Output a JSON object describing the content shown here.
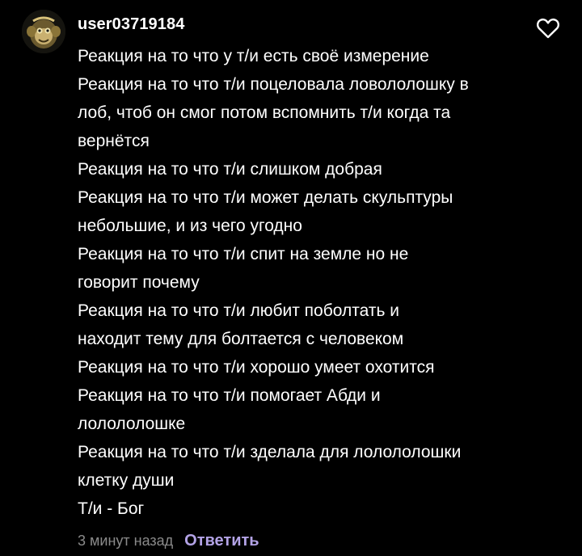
{
  "comment": {
    "username": "user03719184",
    "avatar_icon": "monkey-avatar-icon",
    "like_icon": "heart-outline-icon",
    "lines": [
      "Реакция на то что у т/и есть своё измерение",
      "Реакция на то что т/и поцеловала ловололошку в",
      "лоб, чтоб он смог потом вспомнить т/и когда та",
      "вернётся",
      "Реакция на то что т/и слишком добрая",
      "Реакция на то что т/и может делать скульптуры",
      "небольшие, и из чего угодно",
      "Реакция на то что т/и спит на земле но не",
      "говорит почему",
      "Реакция на то что т/и любит поболтать и",
      "находит тему для болтается с человеком",
      "Реакция на то что т/и хорошо умеет охотится",
      "Реакция на то что т/и помогает Абди и",
      "лолололошке",
      "Реакция на то что т/и зделала для лолололошки",
      "клетку души",
      "Т/и - Бог"
    ],
    "timestamp": "3 минут назад",
    "reply_label": "Ответить"
  },
  "colors": {
    "background": "#000000",
    "text": "#ffffff",
    "timestamp": "#8a8a8a",
    "reply_accent": "#b3a3e6"
  }
}
